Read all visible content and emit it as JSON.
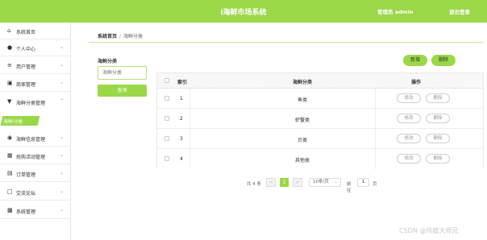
{
  "header": {
    "title": "i海鲜市场系统",
    "admin_label": "管理员 admin",
    "logout_label": "退出登录"
  },
  "colors": {
    "accent": "#9ad848"
  },
  "sidebar": {
    "items": [
      {
        "label": "系统首页",
        "icon": "home-icon",
        "expandable": false
      },
      {
        "label": "个人中心",
        "icon": "user-icon",
        "expandable": true
      },
      {
        "label": "用户管理",
        "icon": "list-icon",
        "expandable": true
      },
      {
        "label": "商家管理",
        "icon": "store-icon",
        "expandable": true
      },
      {
        "label": "海鲜分类管理",
        "icon": "trophy-icon",
        "expandable": true,
        "expanded": true
      },
      {
        "label": "海鲜信息管理",
        "icon": "pin-icon",
        "expandable": true
      },
      {
        "label": "抢购活动管理",
        "icon": "grid-icon",
        "expandable": true
      },
      {
        "label": "订单管理",
        "icon": "order-icon",
        "expandable": true
      },
      {
        "label": "交流论坛",
        "icon": "forum-icon",
        "expandable": true
      },
      {
        "label": "系统管理",
        "icon": "chart-icon",
        "expandable": true
      }
    ],
    "active_sub": "海鲜分类"
  },
  "breadcrumb": {
    "home": "系统首页",
    "separator": "/",
    "current": "海鲜分类"
  },
  "search": {
    "label": "海鲜分类",
    "placeholder": "海鲜分类",
    "button": "查询"
  },
  "actions": {
    "add": "新增",
    "delete": "删除"
  },
  "table": {
    "columns": [
      "索引",
      "海鲜分类",
      "操作"
    ],
    "rows": [
      {
        "index": "1",
        "name": "鱼类"
      },
      {
        "index": "2",
        "name": "虾蟹类"
      },
      {
        "index": "3",
        "name": "贝类"
      },
      {
        "index": "4",
        "name": "其他类"
      }
    ],
    "row_actions": {
      "edit": "修改",
      "delete": "删除"
    }
  },
  "pagination": {
    "total": "共 4 条",
    "prev": "<",
    "current_page": "1",
    "next": ">",
    "page_size": "10条/页",
    "goto_prefix": "前往",
    "goto_value": "1",
    "goto_suffix": "页"
  },
  "watermark": "CSDN @伟庭大师兄"
}
